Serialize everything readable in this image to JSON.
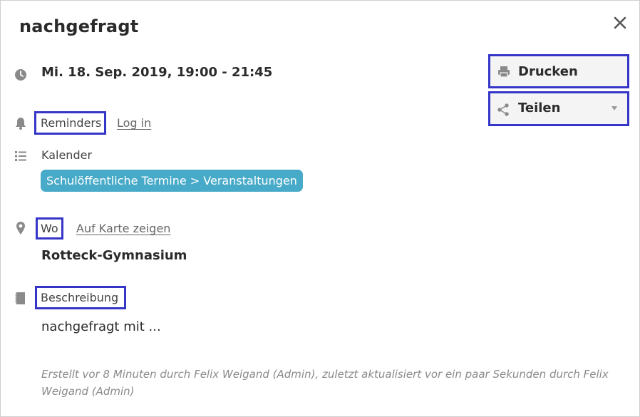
{
  "dialog": {
    "title": "nachgefragt",
    "datetime": "Mi. 18. Sep. 2019, 19:00 - 21:45",
    "reminders_label": "Reminders",
    "login_link": "Log in",
    "calendar_label": "Kalender",
    "calendar_badge": "Schulöffentliche Termine > Veranstaltungen",
    "where_label": "Wo",
    "map_link": "Auf Karte zeigen",
    "location": "Rotteck-Gymnasium",
    "description_label": "Beschreibung",
    "description": "nachgefragt mit ...",
    "meta": "Erstellt vor 8 Minuten durch Felix Weigand (Admin), zuletzt aktualisiert vor ein paar Sekunden durch Felix Weigand (Admin)"
  },
  "actions": {
    "print_label": "Drucken",
    "share_label": "Teilen"
  },
  "colors": {
    "badge": "#47aac8",
    "highlight": "#3535c8",
    "icon": "#8a8a8a"
  },
  "icons": [
    "clock-icon",
    "bell-icon",
    "list-icon",
    "map-pin-icon",
    "notepad-icon",
    "printer-icon",
    "share-icon",
    "close-icon",
    "caret-down-icon"
  ]
}
